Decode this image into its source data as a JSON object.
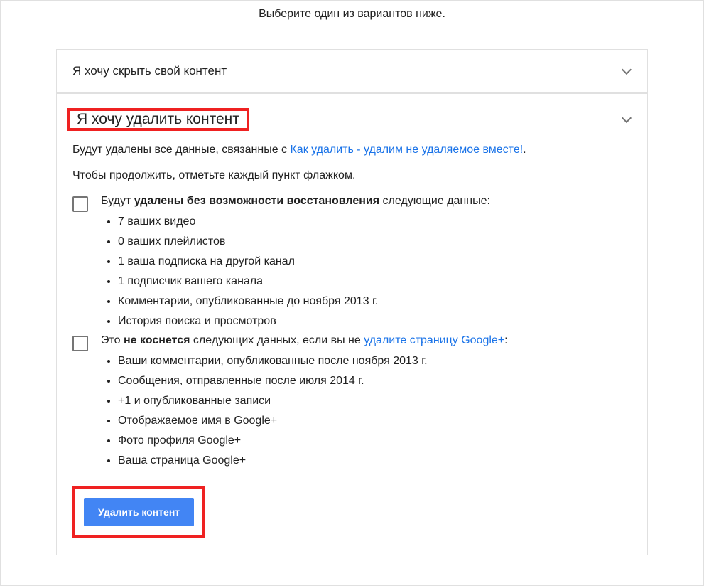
{
  "header": {
    "instruction": "Выберите один из вариантов ниже."
  },
  "sections": {
    "hide": {
      "title": "Я хочу скрыть свой контент"
    },
    "delete": {
      "title": "Я хочу удалить контент",
      "intro_prefix": "Будут удалены все данные, связанные с ",
      "intro_link": "Как удалить - удалим не удаляемое вместе!",
      "intro_suffix": ".",
      "continue_text": "Чтобы продолжить, отметьте каждый пункт флажком.",
      "check1": {
        "prefix": "Будут ",
        "bold": "удалены без возможности восстановления",
        "suffix": " следующие данные:",
        "items": [
          "7 ваших видео",
          "0 ваших плейлистов",
          "1 ваша подписка на другой канал",
          "1 подписчик вашего канала",
          "Комментарии, опубликованные до ноября 2013 г.",
          "История поиска и просмотров"
        ]
      },
      "check2": {
        "prefix": "Это ",
        "bold": "не коснется",
        "middle": " следующих данных, если вы не ",
        "link": "удалите страницу Google+",
        "suffix": ":",
        "items": [
          "Ваши комментарии, опубликованные после ноября 2013 г.",
          "Сообщения, отправленные после июля 2014 г.",
          "+1 и опубликованные записи",
          "Отображаемое имя в Google+",
          "Фото профиля Google+",
          "Ваша страница Google+"
        ]
      },
      "button_label": "Удалить контент"
    }
  }
}
